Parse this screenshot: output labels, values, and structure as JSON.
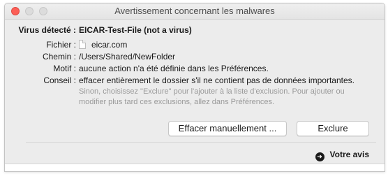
{
  "window": {
    "title": "Avertissement concernant les malwares"
  },
  "alert": {
    "virus_label": "Virus détecté :",
    "virus_value": "EICAR-Test-File (not a virus)",
    "file_label": "Fichier :",
    "file_value": "eicar.com",
    "path_label": "Chemin :",
    "path_value": "/Users/Shared/NewFolder",
    "reason_label": "Motif :",
    "reason_value": "aucune action n'a été définie dans les Préférences.",
    "advice_label": "Conseil :",
    "advice_value": "effacer entièrement le dossier s'il ne contient pas de données importantes.",
    "advice_sub_1": "Sinon, choisissez \"Exclure\" pour l'ajouter à la liste d'exclusion. Pour ajouter ou",
    "advice_sub_2": "modifier plus tard ces exclusions, allez dans Préférences."
  },
  "buttons": {
    "delete_manually": "Effacer manuellement ...",
    "exclude": "Exclure"
  },
  "feedback": {
    "label": "Votre avis",
    "icon": "arrow-right-circle-icon"
  },
  "colors": {
    "close": "#fc5f57",
    "window_bg": "#ececec",
    "secondary_text": "#9a9a9a"
  }
}
